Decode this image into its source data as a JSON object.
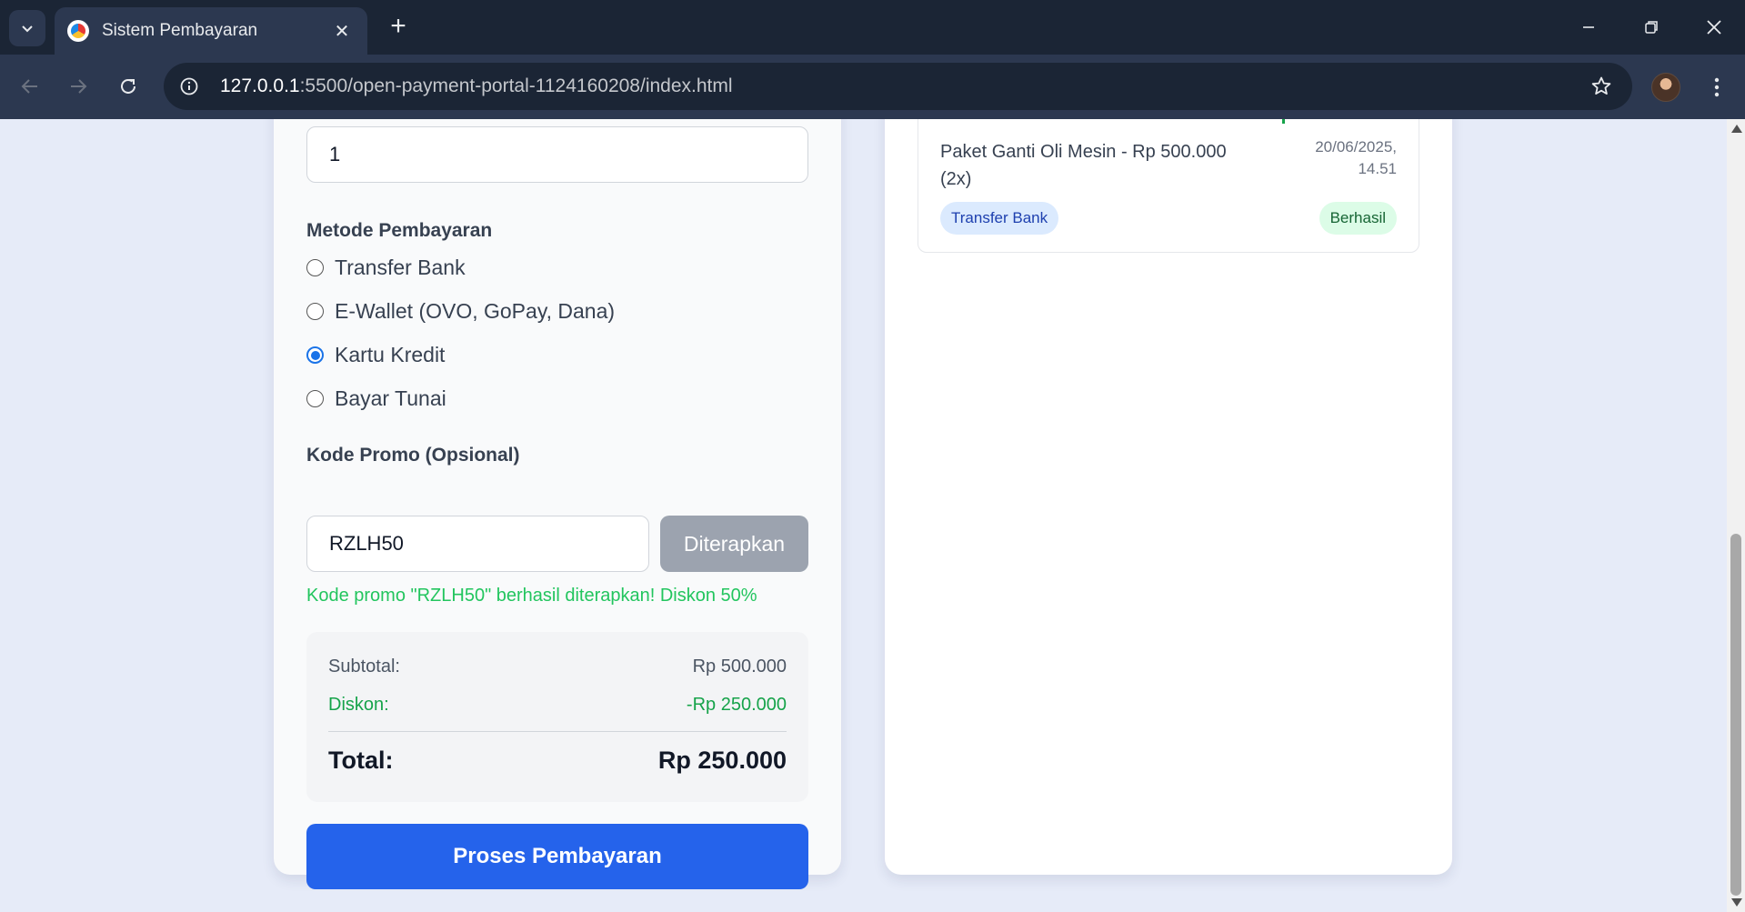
{
  "browser": {
    "tab_title": "Sistem Pembayaran",
    "url_host": "127.0.0.1",
    "url_path": ":5500/open-payment-portal-1124160208/index.html",
    "new_tab_glyph": "+",
    "close_glyph": "✕"
  },
  "form": {
    "quantity_value": "1",
    "payment_method_label": "Metode Pembayaran",
    "payment_methods": [
      {
        "label": "Transfer Bank",
        "selected": false
      },
      {
        "label": "E-Wallet (OVO, GoPay, Dana)",
        "selected": false
      },
      {
        "label": "Kartu Kredit",
        "selected": true
      },
      {
        "label": "Bayar Tunai",
        "selected": false
      }
    ],
    "promo_label": "Kode Promo (Opsional)",
    "promo_value": "RZLH50",
    "promo_button": "Diterapkan",
    "promo_message": "Kode promo \"RZLH50\" berhasil diterapkan! Diskon 50%",
    "summary": {
      "subtotal_label": "Subtotal:",
      "subtotal_value": "Rp 500.000",
      "discount_label": "Diskon:",
      "discount_value": "-Rp 250.000",
      "total_label": "Total:",
      "total_value": "Rp 250.000"
    },
    "submit_button": "Proses Pembayaran"
  },
  "history": {
    "items": [
      {
        "name": "Paket Ganti Oli Mesin - Rp 500.000 (2x)",
        "date_line1": "20/06/2025,",
        "date_line2": "14.51",
        "method": "Transfer Bank",
        "status": "Berhasil"
      }
    ]
  },
  "colors": {
    "primary": "#2563eb",
    "success": "#22c55e",
    "disabled": "#9ca3af",
    "page_bg": "#e6ebf8"
  }
}
